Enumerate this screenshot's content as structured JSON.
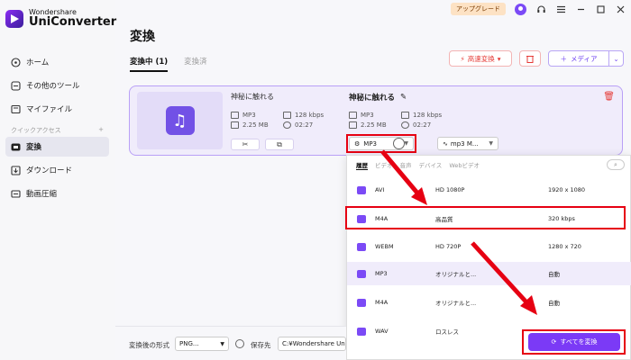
{
  "app": {
    "brand_sub": "Wondershare",
    "brand_main": "UniConverter"
  },
  "sidebar": {
    "items": [
      {
        "label": "ホーム",
        "icon": "home-icon"
      },
      {
        "label": "その他のツール",
        "icon": "tools-icon"
      },
      {
        "label": "マイファイル",
        "icon": "file-icon"
      }
    ],
    "section_label": "クイックアクセス",
    "section_add": "+",
    "quick": [
      {
        "label": "変換",
        "icon": "convert-icon",
        "active": true
      },
      {
        "label": "ダウンロード",
        "icon": "download-icon"
      },
      {
        "label": "動画圧縮",
        "icon": "compress-icon"
      }
    ]
  },
  "topbar": {
    "upgrade": "アップグレード"
  },
  "header": {
    "title": "変換",
    "tabs": [
      {
        "label": "変換中 (1)",
        "active": true
      },
      {
        "label": "変換済",
        "active": false
      }
    ],
    "speed_label": "高速変換",
    "media_label": "メディア"
  },
  "file": {
    "source_name": "神秘に触れる",
    "source_format": "MP3",
    "source_bitrate": "128 kbps",
    "source_size": "2.25 MB",
    "source_duration": "02:27",
    "output_name": "神秘に触れる",
    "output_format": "MP3",
    "output_bitrate": "128 kbps",
    "output_size": "2.25 MB",
    "output_duration": "02:27",
    "format_select": "MP3",
    "quality_select": "mp3 M..."
  },
  "panel": {
    "tabs": [
      {
        "label": "履歴",
        "active": true
      },
      {
        "label": "ビデオ",
        "active": false
      },
      {
        "label": "音声",
        "active": false
      },
      {
        "label": "デバイス",
        "active": false
      },
      {
        "label": "Webビデオ",
        "active": false
      }
    ],
    "rows": [
      {
        "name": "AVI",
        "quality": "HD 1080P",
        "detail": "1920 x 1080",
        "type": "video"
      },
      {
        "name": "M4A",
        "quality": "高品質",
        "detail": "320 kbps",
        "type": "audio"
      },
      {
        "name": "WEBM",
        "quality": "HD 720P",
        "detail": "1280 x 720",
        "type": "video"
      },
      {
        "name": "MP3",
        "quality": "オリジナルと...",
        "detail": "自動",
        "type": "audio",
        "selected": true
      },
      {
        "name": "M4A",
        "quality": "オリジナルと...",
        "detail": "自動",
        "type": "audio"
      },
      {
        "name": "WAV",
        "quality": "ロスレス",
        "detail": "",
        "type": "audio"
      }
    ]
  },
  "bottom": {
    "format_label": "変換後の形式",
    "format_value": "PNG...",
    "save_label": "保存先",
    "save_value": "C:¥Wondershare UniC..."
  },
  "convert_all": "すべてを変換",
  "colors": {
    "accent": "#7b3af6",
    "annotation": "#e60012",
    "danger": "#e53935"
  }
}
